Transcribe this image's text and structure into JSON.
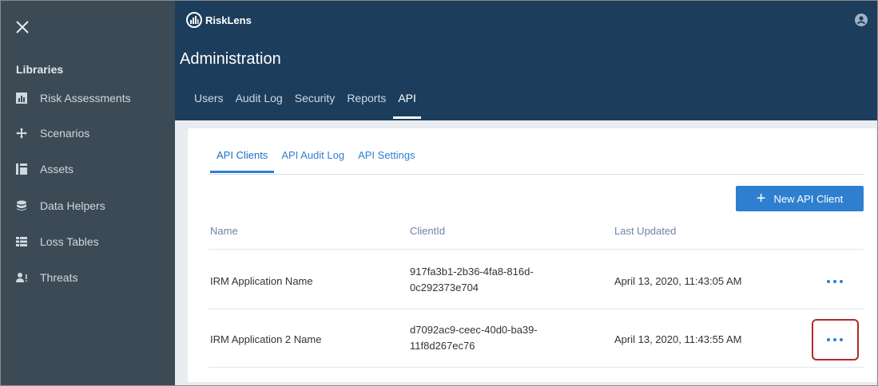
{
  "sidebar": {
    "header": "Libraries",
    "items": [
      {
        "label": "Risk Assessments",
        "icon": "chart-icon"
      },
      {
        "label": "Scenarios",
        "icon": "move-icon"
      },
      {
        "label": "Assets",
        "icon": "assets-icon"
      },
      {
        "label": "Data Helpers",
        "icon": "database-icon"
      },
      {
        "label": "Loss Tables",
        "icon": "table-icon"
      },
      {
        "label": "Threats",
        "icon": "threat-icon"
      }
    ]
  },
  "header": {
    "brand": "RiskLens",
    "title": "Administration",
    "tabs": [
      "Users",
      "Audit Log",
      "Security",
      "Reports",
      "API"
    ],
    "active_tab": "API"
  },
  "api": {
    "subtabs": [
      "API Clients",
      "API Audit Log",
      "API Settings"
    ],
    "active_subtab": "API Clients",
    "new_button_label": "New API Client",
    "columns": [
      "Name",
      "ClientId",
      "Last Updated"
    ],
    "rows": [
      {
        "name": "IRM Application Name",
        "client_id_1": "917fa3b1-2b36-4fa8-816d-",
        "client_id_2": "0c292373e704",
        "last_updated": "April 13, 2020, 11:43:05 AM"
      },
      {
        "name": "IRM Application 2 Name",
        "client_id_1": "d7092ac9-ceec-40d0-ba39-",
        "client_id_2": "11f8d267ec76",
        "last_updated": "April 13, 2020, 11:43:55 AM"
      }
    ]
  },
  "colors": {
    "sidebar_bg": "#3c4a56",
    "header_bg": "#1d3d5c",
    "accent": "#2f7fd0",
    "highlight": "#b22a2a"
  }
}
